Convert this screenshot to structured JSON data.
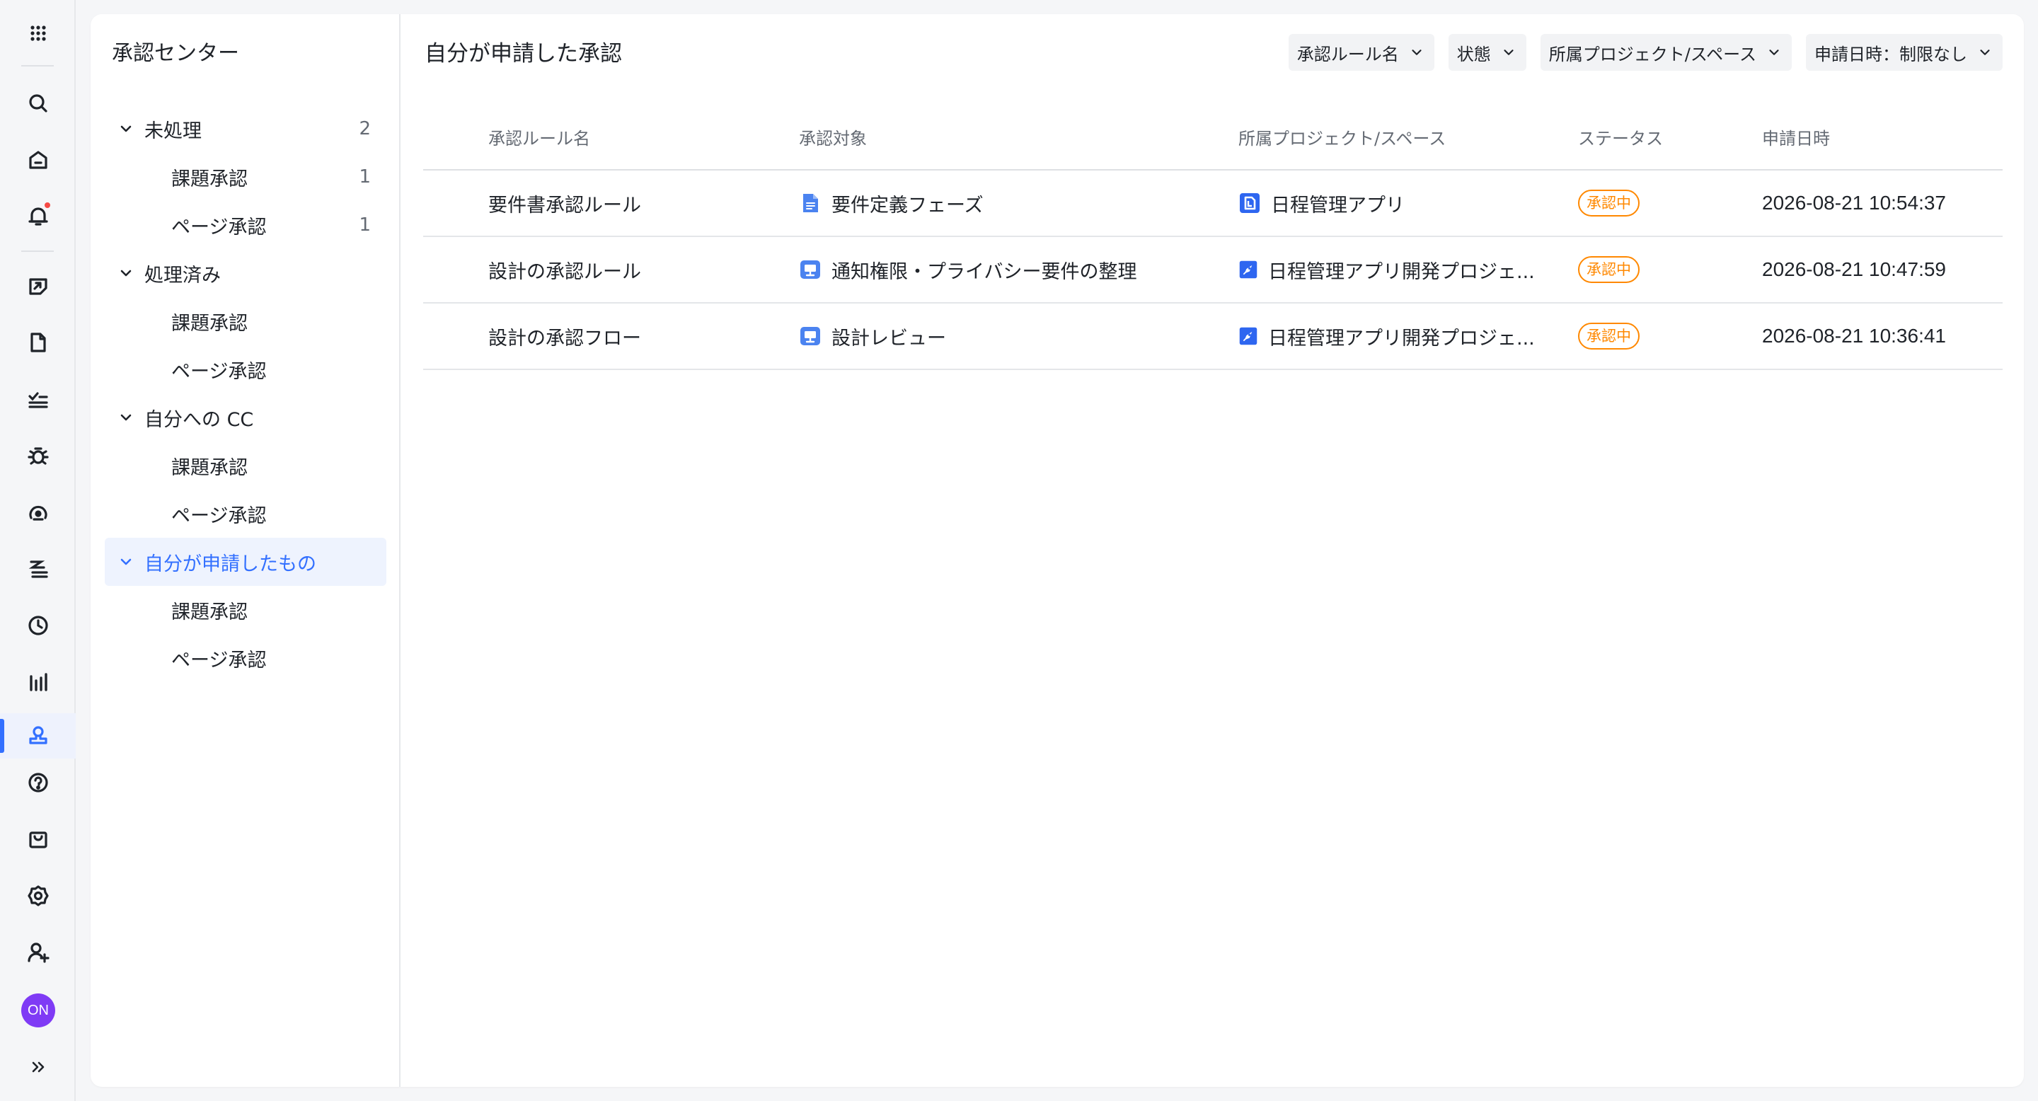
{
  "rail": {
    "items": [
      {
        "icon": "apps-grid-icon"
      },
      {
        "icon": "search-icon"
      },
      {
        "icon": "home-icon"
      },
      {
        "icon": "bell-icon"
      },
      {
        "icon": "project-icon"
      },
      {
        "icon": "document-icon"
      },
      {
        "icon": "task-icon"
      },
      {
        "icon": "bug-icon"
      },
      {
        "icon": "dashboard-icon"
      },
      {
        "icon": "workload-icon"
      },
      {
        "icon": "clock-icon"
      },
      {
        "icon": "chart-icon"
      },
      {
        "icon": "approval-stamp-icon"
      },
      {
        "icon": "help-icon"
      },
      {
        "icon": "shopping-bag-icon"
      },
      {
        "icon": "settings-icon"
      },
      {
        "icon": "add-user-icon"
      }
    ],
    "avatar_text": "ON",
    "accent": "#3370ff",
    "notification_color": "#f54a45"
  },
  "tree": {
    "title": "承認センター",
    "groups": [
      {
        "label": "未処理",
        "count": "2",
        "children": [
          {
            "label": "課題承認",
            "count": "1"
          },
          {
            "label": "ページ承認",
            "count": "1"
          }
        ]
      },
      {
        "label": "処理済み",
        "count": "",
        "children": [
          {
            "label": "課題承認",
            "count": ""
          },
          {
            "label": "ページ承認",
            "count": ""
          }
        ]
      },
      {
        "label": "自分への CC",
        "count": "",
        "children": [
          {
            "label": "課題承認",
            "count": ""
          },
          {
            "label": "ページ承認",
            "count": ""
          }
        ]
      },
      {
        "label": "自分が申請したもの",
        "count": "",
        "selected": true,
        "children": [
          {
            "label": "課題承認",
            "count": ""
          },
          {
            "label": "ページ承認",
            "count": ""
          }
        ]
      }
    ]
  },
  "main": {
    "title": "自分が申請した承認",
    "filters": [
      "承認ルール名",
      "状態",
      "所属プロジェクト/スペース",
      "申請日時：制限なし"
    ],
    "columns": [
      "承認ルール名",
      "承認対象",
      "所属プロジェクト/スペース",
      "ステータス",
      "申請日時"
    ],
    "rows": [
      {
        "rule": "要件書承認ルール",
        "target": "要件定義フェーズ",
        "target_icon": "doc-page-icon",
        "project": "日程管理アプリ",
        "project_icon": "space-icon",
        "status": "承認中",
        "date": "2026-08-21 10:54:37"
      },
      {
        "rule": "設計の承認ルール",
        "target": "通知権限・プライバシー要件の整理",
        "target_icon": "issue-icon",
        "project": "日程管理アプリ開発プロジェ...",
        "project_icon": "project-rocket-icon",
        "status": "承認中",
        "date": "2026-08-21 10:47:59"
      },
      {
        "rule": "設計の承認フロー",
        "target": "設計レビュー",
        "target_icon": "issue-icon",
        "project": "日程管理アプリ開発プロジェ...",
        "project_icon": "project-rocket-icon",
        "status": "承認中",
        "date": "2026-08-21 10:36:41"
      }
    ],
    "status_color": "#ff8800"
  }
}
